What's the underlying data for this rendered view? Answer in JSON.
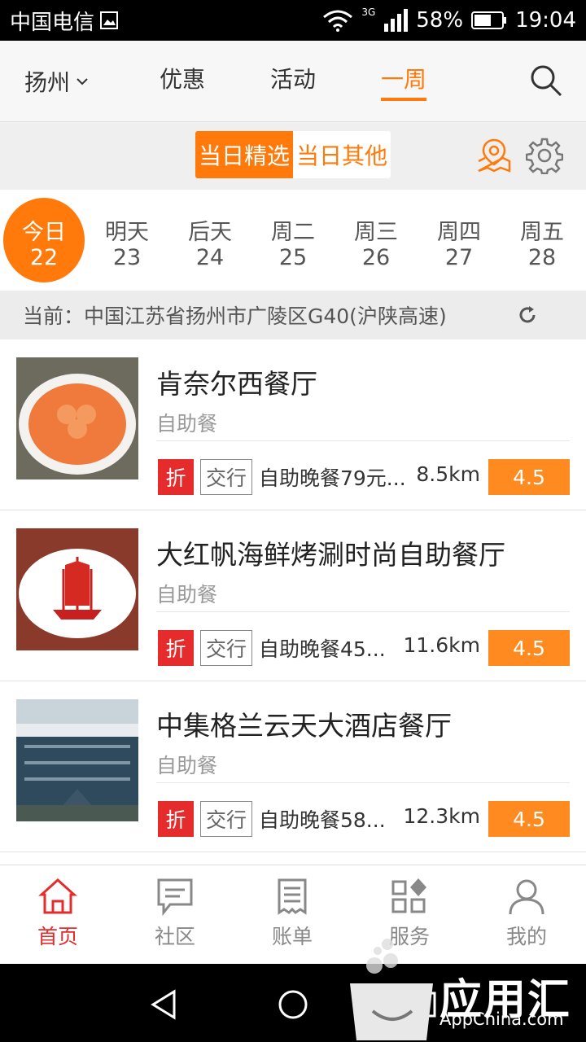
{
  "status_bar": {
    "carrier": "中国电信",
    "network": "3G",
    "battery": "58%",
    "time": "19:04"
  },
  "top_nav": {
    "city": "扬州",
    "tabs": [
      {
        "label": "优惠",
        "active": false
      },
      {
        "label": "活动",
        "active": false
      },
      {
        "label": "一周",
        "active": true
      }
    ]
  },
  "segment": {
    "selected": "当日精选",
    "other": "当日其他"
  },
  "dates": [
    {
      "weekday": "今日",
      "date": "22",
      "active": true
    },
    {
      "weekday": "明天",
      "date": "23",
      "active": false
    },
    {
      "weekday": "后天",
      "date": "24",
      "active": false
    },
    {
      "weekday": "周二",
      "date": "25",
      "active": false
    },
    {
      "weekday": "周三",
      "date": "26",
      "active": false
    },
    {
      "weekday": "周四",
      "date": "27",
      "active": false
    },
    {
      "weekday": "周五",
      "date": "28",
      "active": false
    }
  ],
  "location": {
    "text": "当前：中国江苏省扬州市广陵区G40(沪陕高速)"
  },
  "restaurants": [
    {
      "name": "肯奈尔西餐厅",
      "category": "自助餐",
      "discount_badge": "折",
      "bank_badge": "交行",
      "promo": "自助晚餐79元...",
      "distance": "8.5km",
      "score": "4.5"
    },
    {
      "name": "大红帆海鲜烤涮时尚自助餐厅",
      "category": "自助餐",
      "discount_badge": "折",
      "bank_badge": "交行",
      "promo": "自助晚餐45...",
      "distance": "11.6km",
      "score": "4.5"
    },
    {
      "name": "中集格兰云天大酒店餐厅",
      "category": "自助餐",
      "discount_badge": "折",
      "bank_badge": "交行",
      "promo": "自助晚餐58...",
      "distance": "12.3km",
      "score": "4.5"
    }
  ],
  "bottom_nav": [
    {
      "label": "首页",
      "active": true
    },
    {
      "label": "社区",
      "active": false
    },
    {
      "label": "账单",
      "active": false
    },
    {
      "label": "服务",
      "active": false
    },
    {
      "label": "我的",
      "active": false
    }
  ],
  "watermark": {
    "title": "应用汇",
    "subtitle": "AppChina.com"
  },
  "colors": {
    "accent": "#ff7a0a",
    "badge_red": "#e52b2b",
    "score_orange": "#ff8a1f"
  }
}
